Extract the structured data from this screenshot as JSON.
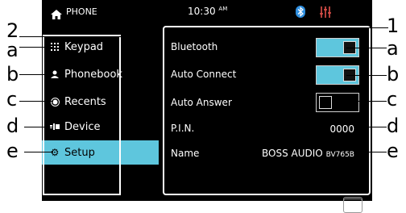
{
  "status": {
    "phone_label": "PHONE",
    "time": "10:30",
    "am_pm": "AM"
  },
  "sidebar": {
    "items": [
      {
        "label": "Keypad",
        "icon": "keypad-icon",
        "active": false
      },
      {
        "label": "Phonebook",
        "icon": "person-icon",
        "active": false
      },
      {
        "label": "Recents",
        "icon": "recents-icon",
        "active": false
      },
      {
        "label": "Device",
        "icon": "device-icon",
        "active": false
      },
      {
        "label": "Setup",
        "icon": "gear-icon",
        "active": true
      }
    ]
  },
  "settings": {
    "bluetooth": {
      "label": "Bluetooth",
      "state": "on"
    },
    "auto_connect": {
      "label": "Auto Connect",
      "state": "on"
    },
    "auto_answer": {
      "label": "Auto Answer",
      "state": "off"
    },
    "pin": {
      "label": "P.I.N.",
      "value": "0000"
    },
    "name": {
      "label": "Name",
      "value_main": "BOSS AUDIO",
      "value_model": "BV765B"
    }
  },
  "callouts": {
    "left_group": "2",
    "right_group": "1",
    "left": [
      "a",
      "b",
      "c",
      "d",
      "e"
    ],
    "right": [
      "a",
      "b",
      "c",
      "d",
      "e"
    ]
  },
  "colors": {
    "accent": "#5ec6dd",
    "bluetooth_icon": "#2f8fe0",
    "eq_icon": "#e0504a"
  }
}
